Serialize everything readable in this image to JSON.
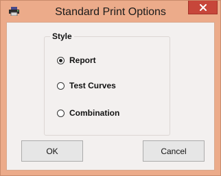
{
  "window": {
    "title": "Standard Print Options"
  },
  "style_group": {
    "legend": "Style",
    "options": [
      {
        "label": "Report",
        "selected": true
      },
      {
        "label": "Test Curves",
        "selected": false
      },
      {
        "label": "Combination",
        "selected": false
      }
    ]
  },
  "buttons": {
    "ok_label": "OK",
    "cancel_label": "Cancel"
  },
  "icons": {
    "app": "printer-icon",
    "close": "close-icon"
  },
  "colors": {
    "frame": "#ecab8a",
    "close_button": "#c7463a",
    "client_background": "#f3f0ef"
  }
}
